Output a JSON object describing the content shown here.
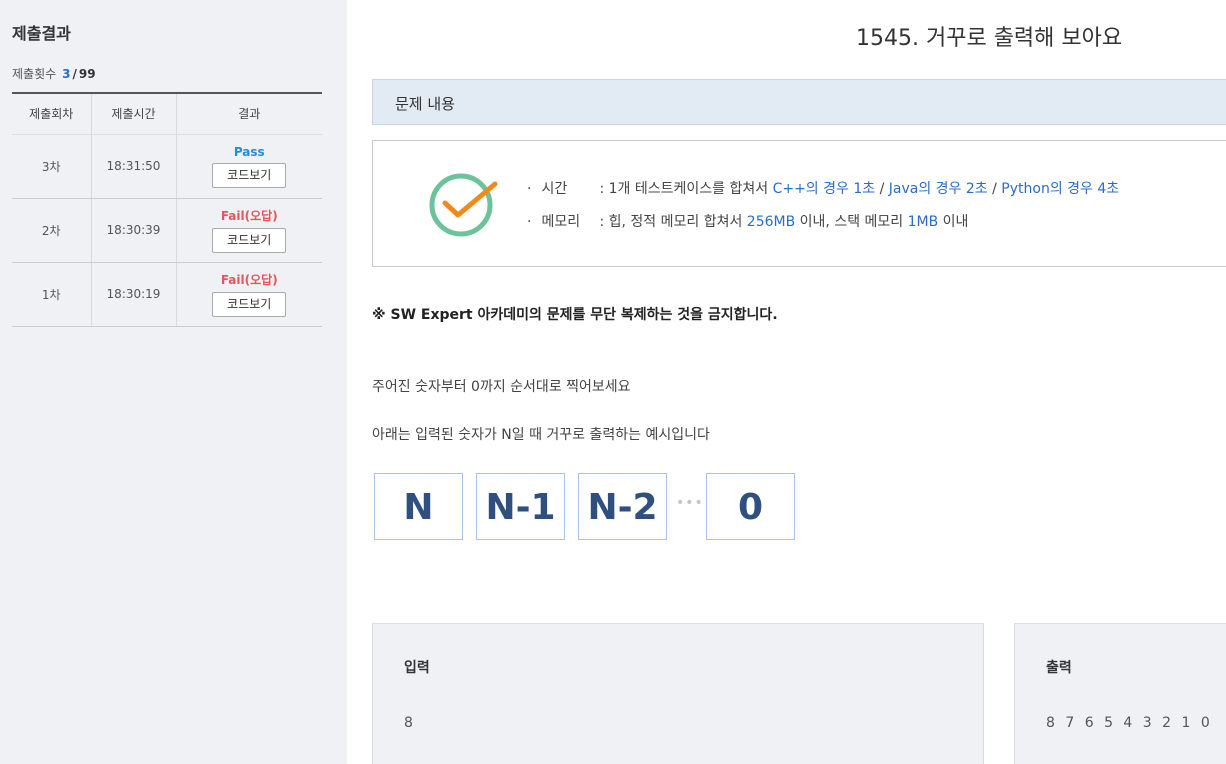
{
  "sidebar": {
    "title": "제출결과",
    "count_label": "제출횟수",
    "count_num": "3",
    "count_sep": "/",
    "count_total": "99",
    "table": {
      "headers": [
        "제출회차",
        "제출시간",
        "결과"
      ],
      "rows": [
        {
          "round": "3차",
          "time": "18:31:50",
          "result": "Pass",
          "status": "pass",
          "button": "코드보기"
        },
        {
          "round": "2차",
          "time": "18:30:39",
          "result": "Fail(오답)",
          "status": "fail",
          "button": "코드보기"
        },
        {
          "round": "1차",
          "time": "18:30:19",
          "result": "Fail(오답)",
          "status": "fail",
          "button": "코드보기"
        }
      ]
    }
  },
  "problem": {
    "title": "1545. 거꾸로 출력해 보아요",
    "section": "문제 내용",
    "constraints": {
      "bullet": "·",
      "time_label": "시간",
      "time_prefix": ": 1개 테스트케이스를 합쳐서 ",
      "time_cpp": "C++의 경우 1초",
      "sep": " / ",
      "time_java": "Java의 경우 2초",
      "time_python": "Python의 경우 4초",
      "mem_label": "메모리",
      "mem_prefix": ": 힙, 정적 메모리 합쳐서 ",
      "mem_heap": "256MB",
      "mem_mid": " 이내, 스택 메모리 ",
      "mem_stack": "1MB",
      "mem_suffix": " 이내"
    },
    "notice": "※ SW Expert 아카데미의 문제를 무단 복제하는 것을 금지합니다.",
    "desc1": "주어진 숫자부터 0까지 순서대로 찍어보세요",
    "desc2": "아래는 입력된 숫자가 N일 때 거꾸로 출력하는 예시입니다",
    "example_boxes": [
      "N",
      "N-1",
      "N-2",
      "0"
    ],
    "ellipsis": "•••",
    "input_label": "입력",
    "input_value": "8",
    "output_label": "출력",
    "output_value": "8 7 6 5 4 3 2 1 0"
  },
  "colors": {
    "link_blue": "#2b6cc4",
    "pass": "#2a8bd6",
    "fail": "#e0595a",
    "check_green": "#6cc29a",
    "check_orange": "#f08a1c"
  },
  "icons": [
    "check-circle-icon"
  ]
}
